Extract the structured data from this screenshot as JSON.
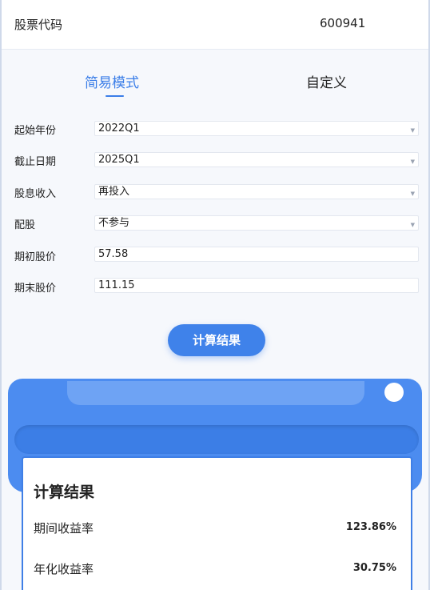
{
  "stock": {
    "label": "股票代码",
    "code": "600941"
  },
  "tabs": [
    {
      "label": "简易模式",
      "active": true
    },
    {
      "label": "自定义",
      "active": false
    }
  ],
  "form": {
    "start_year": {
      "label": "起始年份",
      "value": "2022Q1"
    },
    "end_date": {
      "label": "截止日期",
      "value": "2025Q1"
    },
    "dividend": {
      "label": "股息收入",
      "value": "再投入"
    },
    "rights_issue": {
      "label": "配股",
      "value": "不参与"
    },
    "start_price": {
      "label": "期初股价",
      "value": "57.58"
    },
    "end_price": {
      "label": "期末股价",
      "value": "111.15"
    }
  },
  "calc_button": {
    "label": "计算结果"
  },
  "result": {
    "title": "计算结果",
    "period_return": {
      "label": "期间收益率",
      "value": "123.86%"
    },
    "annual_return": {
      "label": "年化收益率",
      "value": "30.75%"
    }
  },
  "colors": {
    "accent": "#3f82ea",
    "printer": "#4c8cf0"
  },
  "icons": {
    "dropdown": "caret-down-icon"
  }
}
